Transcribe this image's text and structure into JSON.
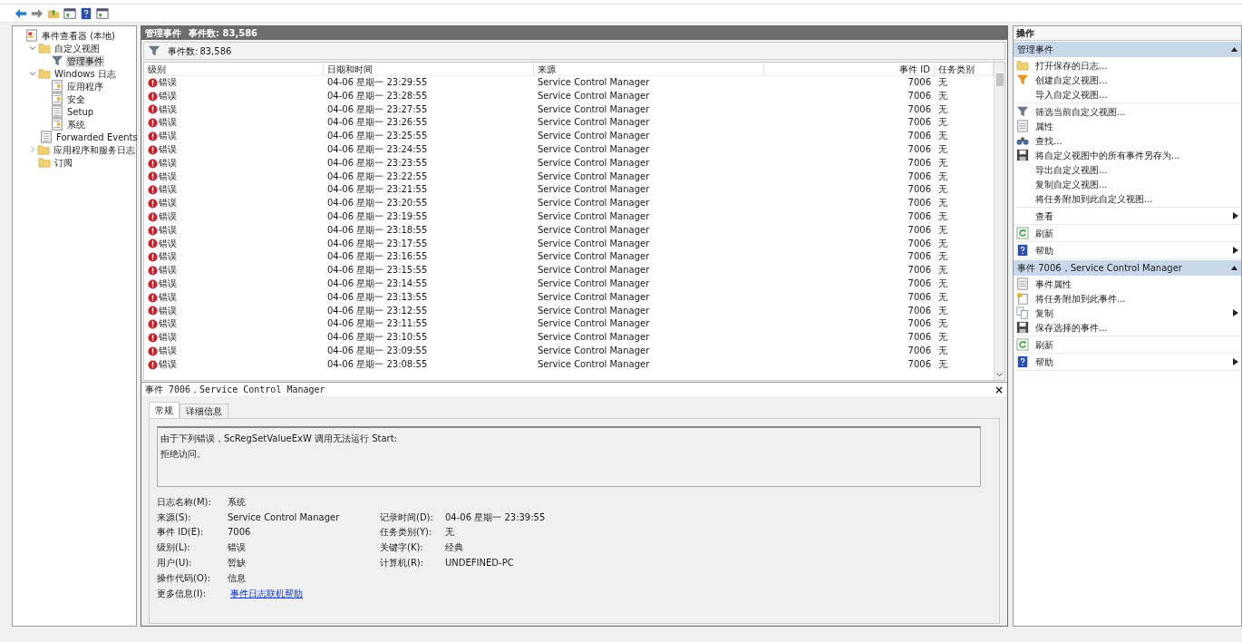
{
  "tree": [
    {
      "label": "事件查看器 (本地)",
      "kind": "root",
      "selected": false,
      "children": [
        {
          "label": "自定义视图",
          "kind": "folder",
          "expanded": true,
          "selected": false,
          "children": [
            {
              "label": "管理事件",
              "kind": "filter",
              "selected": true
            }
          ]
        },
        {
          "label": "Windows 日志",
          "kind": "folder",
          "expanded": true,
          "selected": false,
          "children": [
            {
              "label": "应用程序",
              "kind": "log",
              "selected": false
            },
            {
              "label": "安全",
              "kind": "log",
              "selected": false
            },
            {
              "label": "Setup",
              "kind": "plain",
              "selected": false
            },
            {
              "label": "系统",
              "kind": "log",
              "selected": false
            },
            {
              "label": "Forwarded Events",
              "kind": "plain",
              "selected": false
            }
          ]
        },
        {
          "label": "应用程序和服务日志",
          "kind": "folder",
          "expanded": false,
          "selected": false
        },
        {
          "label": "订阅",
          "kind": "folder",
          "selected": false
        }
      ]
    }
  ],
  "center": {
    "title": "管理事件",
    "count": "事件数: 83,586",
    "filter_count_label": "事件数:",
    "filter_count": "83,586",
    "columns": [
      "级别",
      "日期和时间",
      "来源",
      "事件 ID",
      "任务类别"
    ],
    "rows": [
      {
        "level": "错误",
        "time": "04-06 星期一 23:29:55",
        "source": "Service Control Manager",
        "id": "7006",
        "task": "无",
        "selected": false
      },
      {
        "level": "错误",
        "time": "04-06 星期一 23:28:55",
        "source": "Service Control Manager",
        "id": "7006",
        "task": "无",
        "selected": false
      },
      {
        "level": "错误",
        "time": "04-06 星期一 23:27:55",
        "source": "Service Control Manager",
        "id": "7006",
        "task": "无",
        "selected": false
      },
      {
        "level": "错误",
        "time": "04-06 星期一 23:26:55",
        "source": "Service Control Manager",
        "id": "7006",
        "task": "无",
        "selected": false
      },
      {
        "level": "错误",
        "time": "04-06 星期一 23:25:55",
        "source": "Service Control Manager",
        "id": "7006",
        "task": "无",
        "selected": false
      },
      {
        "level": "错误",
        "time": "04-06 星期一 23:24:55",
        "source": "Service Control Manager",
        "id": "7006",
        "task": "无",
        "selected": false
      },
      {
        "level": "错误",
        "time": "04-06 星期一 23:23:55",
        "source": "Service Control Manager",
        "id": "7006",
        "task": "无",
        "selected": false
      },
      {
        "level": "错误",
        "time": "04-06 星期一 23:22:55",
        "source": "Service Control Manager",
        "id": "7006",
        "task": "无",
        "selected": false
      },
      {
        "level": "错误",
        "time": "04-06 星期一 23:21:55",
        "source": "Service Control Manager",
        "id": "7006",
        "task": "无",
        "selected": false
      },
      {
        "level": "错误",
        "time": "04-06 星期一 23:20:55",
        "source": "Service Control Manager",
        "id": "7006",
        "task": "无",
        "selected": false
      },
      {
        "level": "错误",
        "time": "04-06 星期一 23:19:55",
        "source": "Service Control Manager",
        "id": "7006",
        "task": "无",
        "selected": false
      },
      {
        "level": "错误",
        "time": "04-06 星期一 23:18:55",
        "source": "Service Control Manager",
        "id": "7006",
        "task": "无",
        "selected": false
      },
      {
        "level": "错误",
        "time": "04-06 星期一 23:17:55",
        "source": "Service Control Manager",
        "id": "7006",
        "task": "无",
        "selected": false
      },
      {
        "level": "错误",
        "time": "04-06 星期一 23:16:55",
        "source": "Service Control Manager",
        "id": "7006",
        "task": "无",
        "selected": false
      },
      {
        "level": "错误",
        "time": "04-06 星期一 23:15:55",
        "source": "Service Control Manager",
        "id": "7006",
        "task": "无",
        "selected": false
      },
      {
        "level": "错误",
        "time": "04-06 星期一 23:14:55",
        "source": "Service Control Manager",
        "id": "7006",
        "task": "无",
        "selected": false
      },
      {
        "level": "错误",
        "time": "04-06 星期一 23:13:55",
        "source": "Service Control Manager",
        "id": "7006",
        "task": "无",
        "selected": false
      },
      {
        "level": "错误",
        "time": "04-06 星期一 23:12:55",
        "source": "Service Control Manager",
        "id": "7006",
        "task": "无",
        "selected": false
      },
      {
        "level": "错误",
        "time": "04-06 星期一 23:11:55",
        "source": "Service Control Manager",
        "id": "7006",
        "task": "无",
        "selected": false
      },
      {
        "level": "错误",
        "time": "04-06 星期一 23:10:55",
        "source": "Service Control Manager",
        "id": "7006",
        "task": "无",
        "selected": false
      },
      {
        "level": "错误",
        "time": "04-06 星期一 23:09:55",
        "source": "Service Control Manager",
        "id": "7006",
        "task": "无",
        "selected": false
      },
      {
        "level": "错误",
        "time": "04-06 星期一 23:08:55",
        "source": "Service Control Manager",
        "id": "7006",
        "task": "无",
        "selected": false
      }
    ]
  },
  "detail": {
    "title": "事件 7006，Service Control Manager",
    "close": "×",
    "tabs": [
      {
        "label": "常规",
        "selected": true
      },
      {
        "label": "详细信息",
        "selected": false
      }
    ],
    "message": [
      "由于下列错误，ScRegSetValueExW 调用无法运行 Start:",
      "拒绝访问。"
    ],
    "fields": [
      [
        {
          "label": "日志名称(M):",
          "value": "系统"
        }
      ],
      [
        {
          "label": "来源(S):",
          "value": "Service Control Manager"
        },
        {
          "label": "记录时间(D):",
          "value": "04-06 星期一 23:39:55"
        }
      ],
      [
        {
          "label": "事件 ID(E):",
          "value": "7006"
        },
        {
          "label": "任务类别(Y):",
          "value": "无"
        }
      ],
      [
        {
          "label": "级别(L):",
          "value": "错误"
        },
        {
          "label": "关键字(K):",
          "value": "经典"
        }
      ],
      [
        {
          "label": "用户(U):",
          "value": "暂缺"
        },
        {
          "label": "计算机(R):",
          "value": "UNDEFINED-PC"
        }
      ],
      [
        {
          "label": "操作代码(O):",
          "value": "信息"
        }
      ],
      [
        {
          "label": "更多信息(I):",
          "value": "事件日志联机帮助",
          "kind": "link"
        }
      ]
    ]
  },
  "actions": {
    "title": "操作",
    "sections": [
      {
        "title": "管理事件",
        "expanded": true,
        "groups": [
          [
            {
              "label": "打开保存的日志...",
              "kind": "folder",
              "submenu": false
            },
            {
              "label": "创建自定义视图...",
              "kind": "funnel",
              "submenu": false
            },
            {
              "label": "导入自定义视图...",
              "kind": "plain",
              "submenu": false
            }
          ],
          [
            {
              "label": "筛选当前自定义视图...",
              "kind": "filter",
              "submenu": false
            },
            {
              "label": "属性",
              "kind": "properties",
              "submenu": false
            },
            {
              "label": "查找...",
              "kind": "binoculars",
              "submenu": false
            },
            {
              "label": "将自定义视图中的所有事件另存为...",
              "kind": "save",
              "submenu": false
            },
            {
              "label": "导出自定义视图...",
              "kind": "plain",
              "submenu": false
            },
            {
              "label": "复制自定义视图...",
              "kind": "plain",
              "submenu": false
            },
            {
              "label": "将任务附加到此自定义视图...",
              "kind": "plain",
              "submenu": false
            }
          ],
          [
            {
              "label": "查看",
              "kind": "plain",
              "submenu": true
            }
          ],
          [
            {
              "label": "刷新",
              "kind": "refresh",
              "submenu": false
            }
          ],
          [
            {
              "label": "帮助",
              "kind": "help",
              "submenu": true
            }
          ]
        ]
      },
      {
        "title": "事件 7006，Service Control Manager",
        "expanded": true,
        "groups": [
          [
            {
              "label": "事件属性",
              "kind": "properties",
              "submenu": false
            },
            {
              "label": "将任务附加到此事件...",
              "kind": "task",
              "submenu": false
            },
            {
              "label": "复制",
              "kind": "copy",
              "submenu": true
            },
            {
              "label": "保存选择的事件...",
              "kind": "save",
              "submenu": false
            }
          ],
          [
            {
              "label": "刷新",
              "kind": "refresh",
              "submenu": false
            }
          ],
          [
            {
              "label": "帮助",
              "kind": "help",
              "submenu": true
            }
          ]
        ]
      }
    ]
  }
}
